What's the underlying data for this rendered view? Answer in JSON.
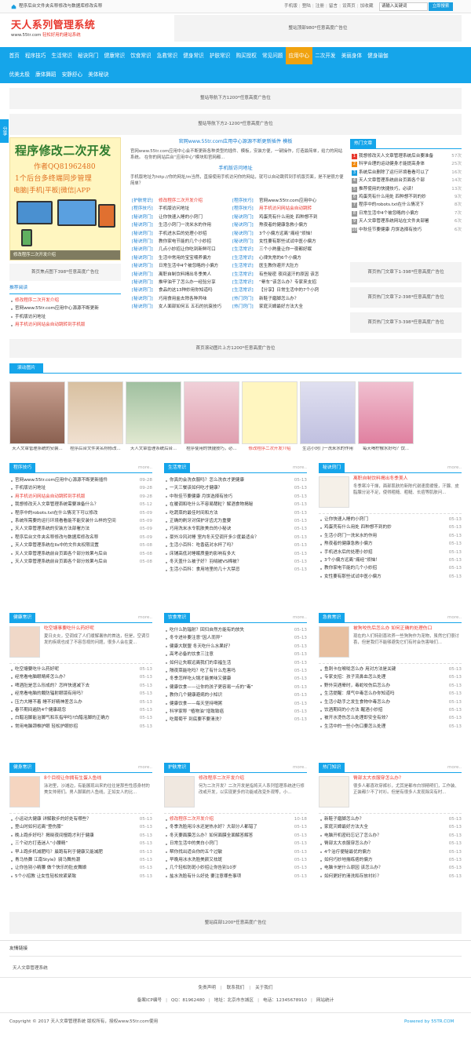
{
  "topbar": {
    "fav_text": "程序后台文件夹名称修改与数据库修改名称",
    "links": [
      "手机版",
      "登陆",
      "注册",
      "留言",
      "设首页",
      "加收藏"
    ],
    "search_value": "请输入关键词",
    "search_button": "立即搜索"
  },
  "logo": {
    "title": "天人系列管理系统",
    "url": "www.55tr.com",
    "slogan": "轻松好用的建站系统"
  },
  "ads": {
    "top_right": "整站顶部980*任意高度广告位",
    "under_nav_1": "整站导航下方1200*任意高度广告位",
    "under_nav_2": "整站导航下方2-1200*任意高度广告位",
    "focus_below": "首页焦点图下398*任意高度广告位",
    "hot_below_1": "首页热门文章下1-398*任意高度广告位",
    "hot_below_2": "首页热门文章下2-398*任意高度广告位",
    "hot_below_3": "首页热门文章下3-398*任意高度广告位",
    "above_scroll": "首页滚动图片上方1200*任意高度广告位",
    "bottom": "整站底部1200*任意高度广告位"
  },
  "nav": {
    "row1": [
      "首页",
      "程序技巧",
      "生活常识",
      "秘诀窍门",
      "健康常识",
      "饮食常识",
      "急救常识",
      "健身常识",
      "护肤常识",
      "购买授权",
      "常见问题",
      "应用中心",
      "二次开发",
      "美丽身体",
      "健身瑜伽"
    ],
    "row2": [
      "优美太极",
      "康体舞蹈",
      "安静舒心",
      "美体秘诀"
    ],
    "active": "应用中心"
  },
  "side_tab": "分享",
  "focus": {
    "headline": "程序修改二次开发",
    "author": "作者QQ81962480",
    "line1": "1个后台多终端同步管理",
    "line2": "电脑|手机|平板|微信|APP",
    "caption": "修改程序二次开发介绍"
  },
  "recommend": {
    "title": "推荐阅读",
    "items": [
      {
        "text": "修改程序二次开发介绍",
        "red": true
      },
      {
        "text": "官网www.55tr.com应用中心源源不断更新",
        "red": false
      },
      {
        "text": "手机版访问地址",
        "red": false
      },
      {
        "text": "用手机访问网站会自动跳转到手机版",
        "red": true
      }
    ]
  },
  "center": {
    "head_title": "官网www.55tr.com应用中心源源不断更新插件 模板",
    "head_desc": "官网www.55tr.com应用中心会不断更新各种类型的插件、模板，安装方便，一键操作，打造最简单，给力的网站系统。 在你的网站后台“应用中心”模块和官网都...",
    "sub_title": "手机版访问地址",
    "sub_desc": "手机版地址为http://你的网址/m当然，直接使用手机访问你的网站，就可以自动跳转到手机版页面，是不是很方便简单？",
    "rows": [
      [
        "[护肤常识]",
        "修改程序二次开发介绍",
        "[程序技巧]",
        "官网www.55tr.com应用中心"
      ],
      [
        "[程序技巧]",
        "手机版访问地址",
        "[程序技巧]",
        "用手机访问网站会自动跳转"
      ],
      [
        "[秘诀窍门]",
        "让你快速入睡的小窍门",
        "[秘诀窍门]",
        "鸡蛋壳有什么用处 四种想不到"
      ],
      [
        "[秘诀窍门]",
        "生活小窍门一洗米水的作用",
        "[秘诀窍门]",
        "熬夜者的健康急救小偏方"
      ],
      [
        "[秘诀窍门]",
        "手机进水后的处理小妙招",
        "[秘诀窍门]",
        "3个小偏方远离“痛经”烦恼！"
      ],
      [
        "[秘诀窍门]",
        "教你家电节能的几个小妙招",
        "[秘诀窍门]",
        "女性要有那些试试中医小偏方"
      ],
      [
        "[秘诀窍门]",
        "几点小妙招让你吃到新鲜可口",
        "[生活常识]",
        "三个小熟量让你一夜都好眠"
      ],
      [
        "[秘诀窍门]",
        "生活中常用的宝宝喂养偏方",
        "[生活常识]",
        "心律失常的6个小偏方"
      ],
      [
        "[秘诀窍门]",
        "日常生活中4个被忽略的小偏方",
        "[生活常识]",
        "医生教你避开大肚方"
      ],
      [
        "[秘诀窍门]",
        "离职自制饮料揭出冬季美人",
        "[生活常识]",
        "有些秘密 夜间盗汗的原因 该怎"
      ],
      [
        "[秘诀窍门]",
        "推甲油干了怎么办一经验分享",
        "[生活常识]",
        "“晕车”该怎么办？专家来支招"
      ],
      [
        "[秘诀窍门]",
        "食品的这13种妙用你知道吗",
        "[生活常识]",
        "【分享】日常生活中的7个小窍"
      ],
      [
        "[秘诀窍门]",
        "巧用食用盐去除各种异味",
        "[热门窍门]",
        "新鞋子磨脚怎么办？"
      ],
      [
        "[秘诀窍门]",
        "女人面部如何五 五石的抗衰技巧",
        "[热门窍门]",
        "家庭灭蟑最好方法大全"
      ]
    ]
  },
  "hot": {
    "title": "热门文章",
    "items": [
      {
        "text": "我想修改天人文章管理系统后台要准备",
        "count": "57次"
      },
      {
        "text": "科学合理的运动健身才能提高身体",
        "count": "25次"
      },
      {
        "text": "系统后台删除了运行环境看看可以了",
        "count": "16次"
      },
      {
        "text": "天人文章管理系统前台页面各个部",
        "count": "14次"
      },
      {
        "text": "推荐使用的快捷技巧，必读！",
        "count": "13次"
      },
      {
        "text": "鸡蛋壳有什么用处 四种想不到的妙",
        "count": "9次"
      },
      {
        "text": "程序中的robots.txt在什么情况下",
        "count": "8次"
      },
      {
        "text": "日常生活中4个被忽略的小偏方",
        "count": "7次"
      },
      {
        "text": "天人文章管理系统网站在文件夹部署",
        "count": "6次"
      },
      {
        "text": "中秋佳节要健康 月饼选择有技巧",
        "count": "6次"
      }
    ]
  },
  "scroll": {
    "title": "滚动图片",
    "items": [
      {
        "caption": "天人文章管理系统的安装...",
        "red": false
      },
      {
        "caption": "程序后台文件夹名称修改...",
        "red": false
      },
      {
        "caption": "天人文章管理系统后台...",
        "red": false
      },
      {
        "caption": "程序使用的快捷技巧，必...",
        "red": false
      },
      {
        "caption": "修改程序二次开发介绍",
        "red": true
      },
      {
        "caption": "生活小窍门一洗米水的作用",
        "red": false
      },
      {
        "caption": "每天喝柠檬水好吗？饮...",
        "red": false
      }
    ]
  },
  "blocks": [
    {
      "title": "程序技巧",
      "more": "more..",
      "items": [
        {
          "t": "官网www.55tr.com应用中心源源不断更新插件",
          "d": "09-28",
          "red": false
        },
        {
          "t": "手机版访问地址",
          "d": "09-28",
          "red": false
        },
        {
          "t": "用手机访问网站会自动跳转到手机版",
          "d": "09-28",
          "red": true
        },
        {
          "t": "我想修改天人文章管理系统需要准备什么？",
          "d": "05-12",
          "red": false
        },
        {
          "t": "程序中的robots.txt在什么情况下可以修改",
          "d": "05-09",
          "red": false
        },
        {
          "t": "系统所需要的运行环境看看能不能安装什么样的空间",
          "d": "05-09",
          "red": false
        },
        {
          "t": "天人文章管理系统的安装方法部署方法",
          "d": "05-09",
          "red": false
        },
        {
          "t": "程序后台文件夹名称修改与数据库修改名称",
          "d": "05-09",
          "red": false
        },
        {
          "t": "天人文章管理系统在IIs中的文件夹权限设置",
          "d": "05-08",
          "red": false
        },
        {
          "t": "天人文章管理系统前台页面各个部分效果与后台",
          "d": "05-08",
          "red": false
        },
        {
          "t": "天人文章管理系统前台页面各个部分效果与后台",
          "d": "05-08",
          "red": false
        }
      ]
    },
    {
      "title": "生活常识",
      "more": "more..",
      "items": [
        {
          "t": "你真的会洗衣服吗？怎么洗衣才更健康",
          "d": "05-13"
        },
        {
          "t": "一天三餐该如何吃才健康？",
          "d": "05-13"
        },
        {
          "t": "中秋佳节要健康 月饼选择有技巧",
          "d": "05-13"
        },
        {
          "t": "在暖调和吃什么不容易酵粒？解酒食物揭秘",
          "d": "05-13"
        },
        {
          "t": "吃蔬菜的最佳时间和方法",
          "d": "05-13"
        },
        {
          "t": "正确的刷牙对保护牙齿尤为重要",
          "d": "05-13"
        },
        {
          "t": "巧用洗米水令肌肤美白的小秘诀",
          "d": "05-13"
        },
        {
          "t": "豪外冷风对睡 室内冬天空调开多少度最适合？",
          "d": "05-13"
        },
        {
          "t": "生活小百科：吃香菇对水杯了吗？",
          "d": "05-13"
        },
        {
          "t": "床铺高低对睡眠质量的影响有多大",
          "d": "05-13"
        },
        {
          "t": "冬天盖什么被子好？羽绒被VS棉被？",
          "d": "05-13"
        },
        {
          "t": "生活小百科：食用地里的几十大禁忌",
          "d": "05-13"
        }
      ]
    },
    {
      "title": "秘诀窍门",
      "more": "more..",
      "feat_title": "离职自制饮料揭出冬季美人",
      "feat_desc": "冬季寒冷干燥，面部肌肤的新陈代谢速度缓慢，汗腺、皮脂腺分泌不足，使得粗糙、粗糙、长痘等肌肤问...",
      "items": [
        {
          "t": "让你快速入睡的小窍门",
          "d": "05-13"
        },
        {
          "t": "鸡蛋壳有什么用处 四种想不到的妙",
          "d": "05-13"
        },
        {
          "t": "生活小窍门一洗米水的作用",
          "d": "05-13"
        },
        {
          "t": "熬夜者的健康急救小偏方",
          "d": "05-13"
        },
        {
          "t": "手机进水后的处理小妙招",
          "d": "05-13"
        },
        {
          "t": "3个小偏方远离“痛经”烦恼！",
          "d": "05-13"
        },
        {
          "t": "教你家电节能的几个小妙招",
          "d": "05-13"
        },
        {
          "t": "女性要有那些试试中医小偏方",
          "d": "05-13"
        }
      ]
    },
    {
      "title": "健康常识",
      "more": "more..",
      "feat_title": "吃空塘事要吃什么药好呢",
      "feat_desc": "夏日炎炎，空调成了人们缓解暑热的首选，但是，空调引发的疾病也成了不容忽视的问题，很多人会在夏...",
      "items": [
        {
          "t": "吃空塘要吃什么药好呢",
          "d": "05-13"
        },
        {
          "t": "经常看电脑眼睛疼怎么办？",
          "d": "05-13"
        },
        {
          "t": "啤酒肚是怎么形成的？怎样快速减下去",
          "d": "05-13"
        },
        {
          "t": "经常看电脑的戴防辐射眼镜有用吗？",
          "d": "05-13"
        },
        {
          "t": "压力大睡不着 睡不好精神差怎么办",
          "d": "05-13"
        },
        {
          "t": "春节期间遍防4个健康疏忽",
          "d": "05-13"
        },
        {
          "t": "白醋泡脚能治脚气和灰指甲吗?白醋泡脚的正确方",
          "d": "05-13"
        },
        {
          "t": "常用电脑颈椎护眼 轻松护眼妙招",
          "d": "05-13"
        }
      ]
    },
    {
      "title": "饮食常识",
      "more": "more..",
      "items": [
        {
          "t": "吃什么防辐射？回归自然方能有的放失",
          "d": "05-13"
        },
        {
          "t": "冬令进补要注意“因人而异”",
          "d": "05-13"
        },
        {
          "t": "健康大联盟 冬天吃什么水果好？",
          "d": "05-13"
        },
        {
          "t": "高考必备的饮食三注意",
          "d": "05-13"
        },
        {
          "t": "如何让失眠远离我们的幸福生活",
          "d": "05-13"
        },
        {
          "t": "隔夜菜能吃吗？吃了有什么危害吗",
          "d": "05-13"
        },
        {
          "t": "冬季怎样吃火锅才能美味又健康",
          "d": "05-13"
        },
        {
          "t": "健康饮食——让你的孩子更容易一点的“毒”",
          "d": "05-13"
        },
        {
          "t": "教你几个健康避病的小知识",
          "d": "05-13"
        },
        {
          "t": "健康饮食——每天坚持喝粥",
          "d": "05-13"
        },
        {
          "t": "科学家称 “植物油”增致致癌",
          "d": "05-13"
        },
        {
          "t": "吃葡萄干 到底要不要清洗？",
          "d": "05-13"
        }
      ]
    },
    {
      "title": "急救常识",
      "more": "more..",
      "feat_title": "被狗咬伤后怎么办 如何正确的处理伤口",
      "feat_desc": "现在的人们特别喜欢养一些狗狗作为宠物，虽然它们很讨喜，但是我们不能够避免它们有时会伤害咱们...",
      "items": [
        {
          "t": "鱼刺卡在喉咙怎么办 用对方法是关键",
          "d": "05-13"
        },
        {
          "t": "专家支招：孩子流鼻血怎么处理",
          "d": "05-13"
        },
        {
          "t": "野外突遇晕时，毒蛇咬伤后怎么办",
          "d": "05-13"
        },
        {
          "t": "生活提醒：煤气中毒怎么办你知道吗",
          "d": "05-13"
        },
        {
          "t": "生活小助手之发生食物中毒怎么办",
          "d": "05-13"
        },
        {
          "t": "饮酒期间的小方法 醒酒小妙招",
          "d": "05-13"
        },
        {
          "t": "被开水烫伤怎么处理即安全有效？",
          "d": "05-13"
        },
        {
          "t": "生活中的一些小伤口要怎么处理",
          "d": "05-13"
        }
      ]
    },
    {
      "title": "健身常识",
      "more": "more..",
      "feat_title": "8个目视让你拥有生蛋人鱼线",
      "feat_desc": "泳池里，沙滩边，有能展现出来的往往是那些性感身材的美女帅哥们。男人脚面的人鱼线，正如女人的比...",
      "items": [
        {
          "t": "小运动大健康 详解散步的好处有哪些？",
          "d": "05-13"
        },
        {
          "t": "登山时如何远离“登伤膝”",
          "d": "05-13"
        },
        {
          "t": "晚上跑步好吗？揭晓夜间慢跑才利于健康",
          "d": "05-13"
        },
        {
          "t": "三个动方打造迷人“小腰精”",
          "d": "05-13"
        },
        {
          "t": "早上跑步机减肥吗？晨跑有利于健康又能减肥",
          "d": "05-13"
        },
        {
          "t": "青马热舞 江南Style》骑马舞热潮",
          "d": "05-13"
        },
        {
          "t": "让你告别小精腰 做个快乐的肚皮舞娘",
          "d": "05-13"
        },
        {
          "t": "5个小招教 让女性轻松效紧紧致",
          "d": "05-13"
        }
      ]
    },
    {
      "title": "护肤常识",
      "more": "more..",
      "feat_title": "修改程序二次开发介绍",
      "feat_desc": "何为二次开发？二次开发是指将天人系列管理系统进行修改或开发，以实现更多的功能或改变外观等，小...",
      "items": [
        {
          "t": "修改程序二次开发介绍",
          "d": "10-18",
          "red": true
        },
        {
          "t": "冬季洗脸用冷水还是热水好？大部分人都错了",
          "d": "05-13"
        },
        {
          "t": "冬天要面膜怎么办？如何面膜全面解答解答",
          "d": "05-13"
        },
        {
          "t": "日常生活中的美白小窍门",
          "d": "05-13"
        },
        {
          "t": "帮你找出适合你的五个过敏",
          "d": "05-13"
        },
        {
          "t": "早晚用冰水洗脸美颜又祛斑",
          "d": "05-13"
        },
        {
          "t": "几个轻松防斑小妙招让你告别10岁",
          "d": "05-13"
        },
        {
          "t": "盐水洗脸有什么好处 要注意哪些事项",
          "d": "05-13"
        }
      ]
    },
    {
      "title": "热门知识",
      "more": "more..",
      "feat_title": "臀部太大衣服穿怎么办？",
      "feat_desc": "很多人都喜欢穿裤衫，尤其是都市白领精明们，工作装、正装都少不了衬衫。但是有很多人发现除突有时...",
      "items": [
        {
          "t": "新鞋子磨脚怎么办？",
          "d": "05-13"
        },
        {
          "t": "家庭灭蟑最好方法大全",
          "d": "05-13"
        },
        {
          "t": "电脑开机密码忘记了怎么办？",
          "d": "05-13"
        },
        {
          "t": "臀部太大衣服穿怎么办？",
          "d": "05-13"
        },
        {
          "t": "4个治疗便秘最优的偏方",
          "d": "05-13"
        },
        {
          "t": "如何巧妙地揣练痞的偏方",
          "d": "05-13"
        },
        {
          "t": "电脑卡是什么原因 该怎么办？",
          "d": "05-13"
        },
        {
          "t": "如何更好的清洗和存放衬衫？",
          "d": "05-13"
        }
      ]
    }
  ],
  "friend": {
    "title": "友情链接",
    "items": [
      "天人文章管理系统"
    ]
  },
  "footer": {
    "links": [
      "免责声明",
      "联系我们",
      "关于我们"
    ],
    "info": [
      "备案ICP编号",
      "QQ：81962480",
      "地址：北京市东城区",
      "电话：12345678910",
      "网站统计"
    ],
    "copyright": "Copyright © 2017 天人文章管理系统 版权所有，授权www.55tr.com使用",
    "powered": "Powered by 55TR.COM"
  },
  "colors": {
    "brand": "#15a5ea",
    "accent_red": "#e8382e",
    "nav_active": "#f0a20f"
  }
}
